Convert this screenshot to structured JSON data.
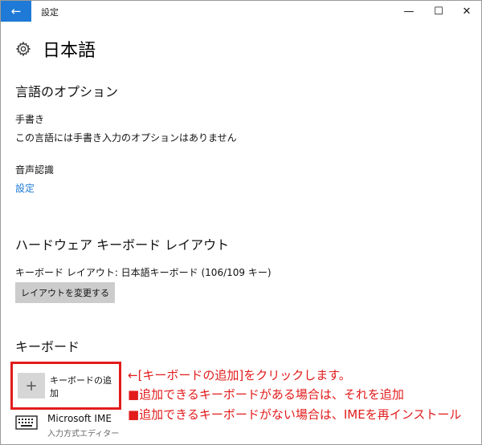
{
  "window": {
    "title": "設定",
    "back_icon": "←",
    "min_icon": "—",
    "max_icon": "☐",
    "close_icon": "✕"
  },
  "page": {
    "title": "日本語"
  },
  "language_options": {
    "heading": "言語のオプション",
    "handwriting_label": "手書き",
    "handwriting_note": "この言語には手書き入力のオプションはありません",
    "speech_label": "音声認識",
    "settings_link": "設定"
  },
  "hardware_layout": {
    "heading": "ハードウェア キーボード レイアウト",
    "layout_text": "キーボード レイアウト: 日本語キーボード (106/109 キー)",
    "change_button": "レイアウトを変更する"
  },
  "keyboard": {
    "heading": "キーボード",
    "add_keyboard_label": "キーボードの追加",
    "plus_icon": "+",
    "ime_name": "Microsoft IME",
    "ime_subtitle": "入力方式エディター"
  },
  "annotations": {
    "line1": "←[キーボードの追加]をクリックします。",
    "line2": "■追加できるキーボードがある場合は、それを追加",
    "line3": "■追加できるキーボードがない場合は、IMEを再インストール"
  },
  "colors": {
    "accent": "#1e7ad6",
    "annotation": "#e21c1c",
    "button_gray": "#cccccc"
  }
}
